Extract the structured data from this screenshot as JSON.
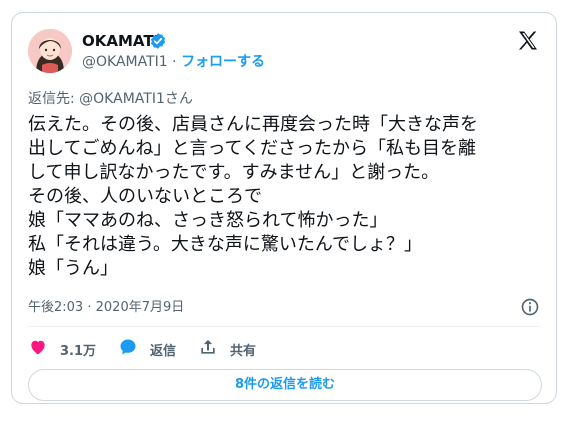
{
  "author": {
    "display_name": "OKAMATI",
    "handle": "@OKAMATI1",
    "separator": "·",
    "follow_label": "フォローする"
  },
  "reply_to": "返信先: @OKAMATI1さん",
  "tweet": {
    "lines": [
      "伝えた。その後、店員さんに再度会った時「大きな声を",
      "出してごめんね」と言ってくださったから「私も目を離",
      "して申し訳なかったです。すみません」と謝った。",
      "その後、人のいないところで",
      "娘「ママあのね、さっき怒られて怖かった」",
      "私「それは違う。大きな声に驚いたんでしょ？」",
      "娘「うん」"
    ]
  },
  "meta": {
    "time": "午後2:03",
    "separator": "·",
    "date": "2020年7月9日"
  },
  "actions": {
    "like_count": "3.1万",
    "reply_label": "返信",
    "share_label": "共有"
  },
  "replies_button_label": "8件の返信を読む",
  "colors": {
    "accent": "#1d9bf0",
    "like": "#f91880",
    "text": "#0f1419",
    "secondary": "#536471",
    "border": "#cfd9de"
  },
  "icons": [
    "verified-badge-icon",
    "x-logo-icon",
    "info-icon",
    "heart-icon",
    "reply-bubble-icon",
    "share-icon"
  ]
}
